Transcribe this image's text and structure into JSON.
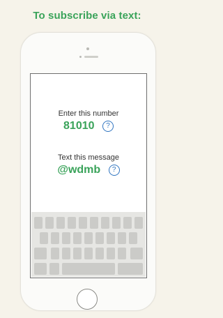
{
  "heading": "To subscribe via text:",
  "number_label": "Enter this number",
  "number_value": "81010",
  "message_label": "Text this message",
  "message_value": "@wdmb",
  "help_glyph": "?",
  "colors": {
    "accent_green": "#3aa35a",
    "help_blue": "#2f74c0",
    "background": "#f6f3ea"
  },
  "icons": {
    "help": "question-circle-icon",
    "home": "home-button-icon"
  }
}
